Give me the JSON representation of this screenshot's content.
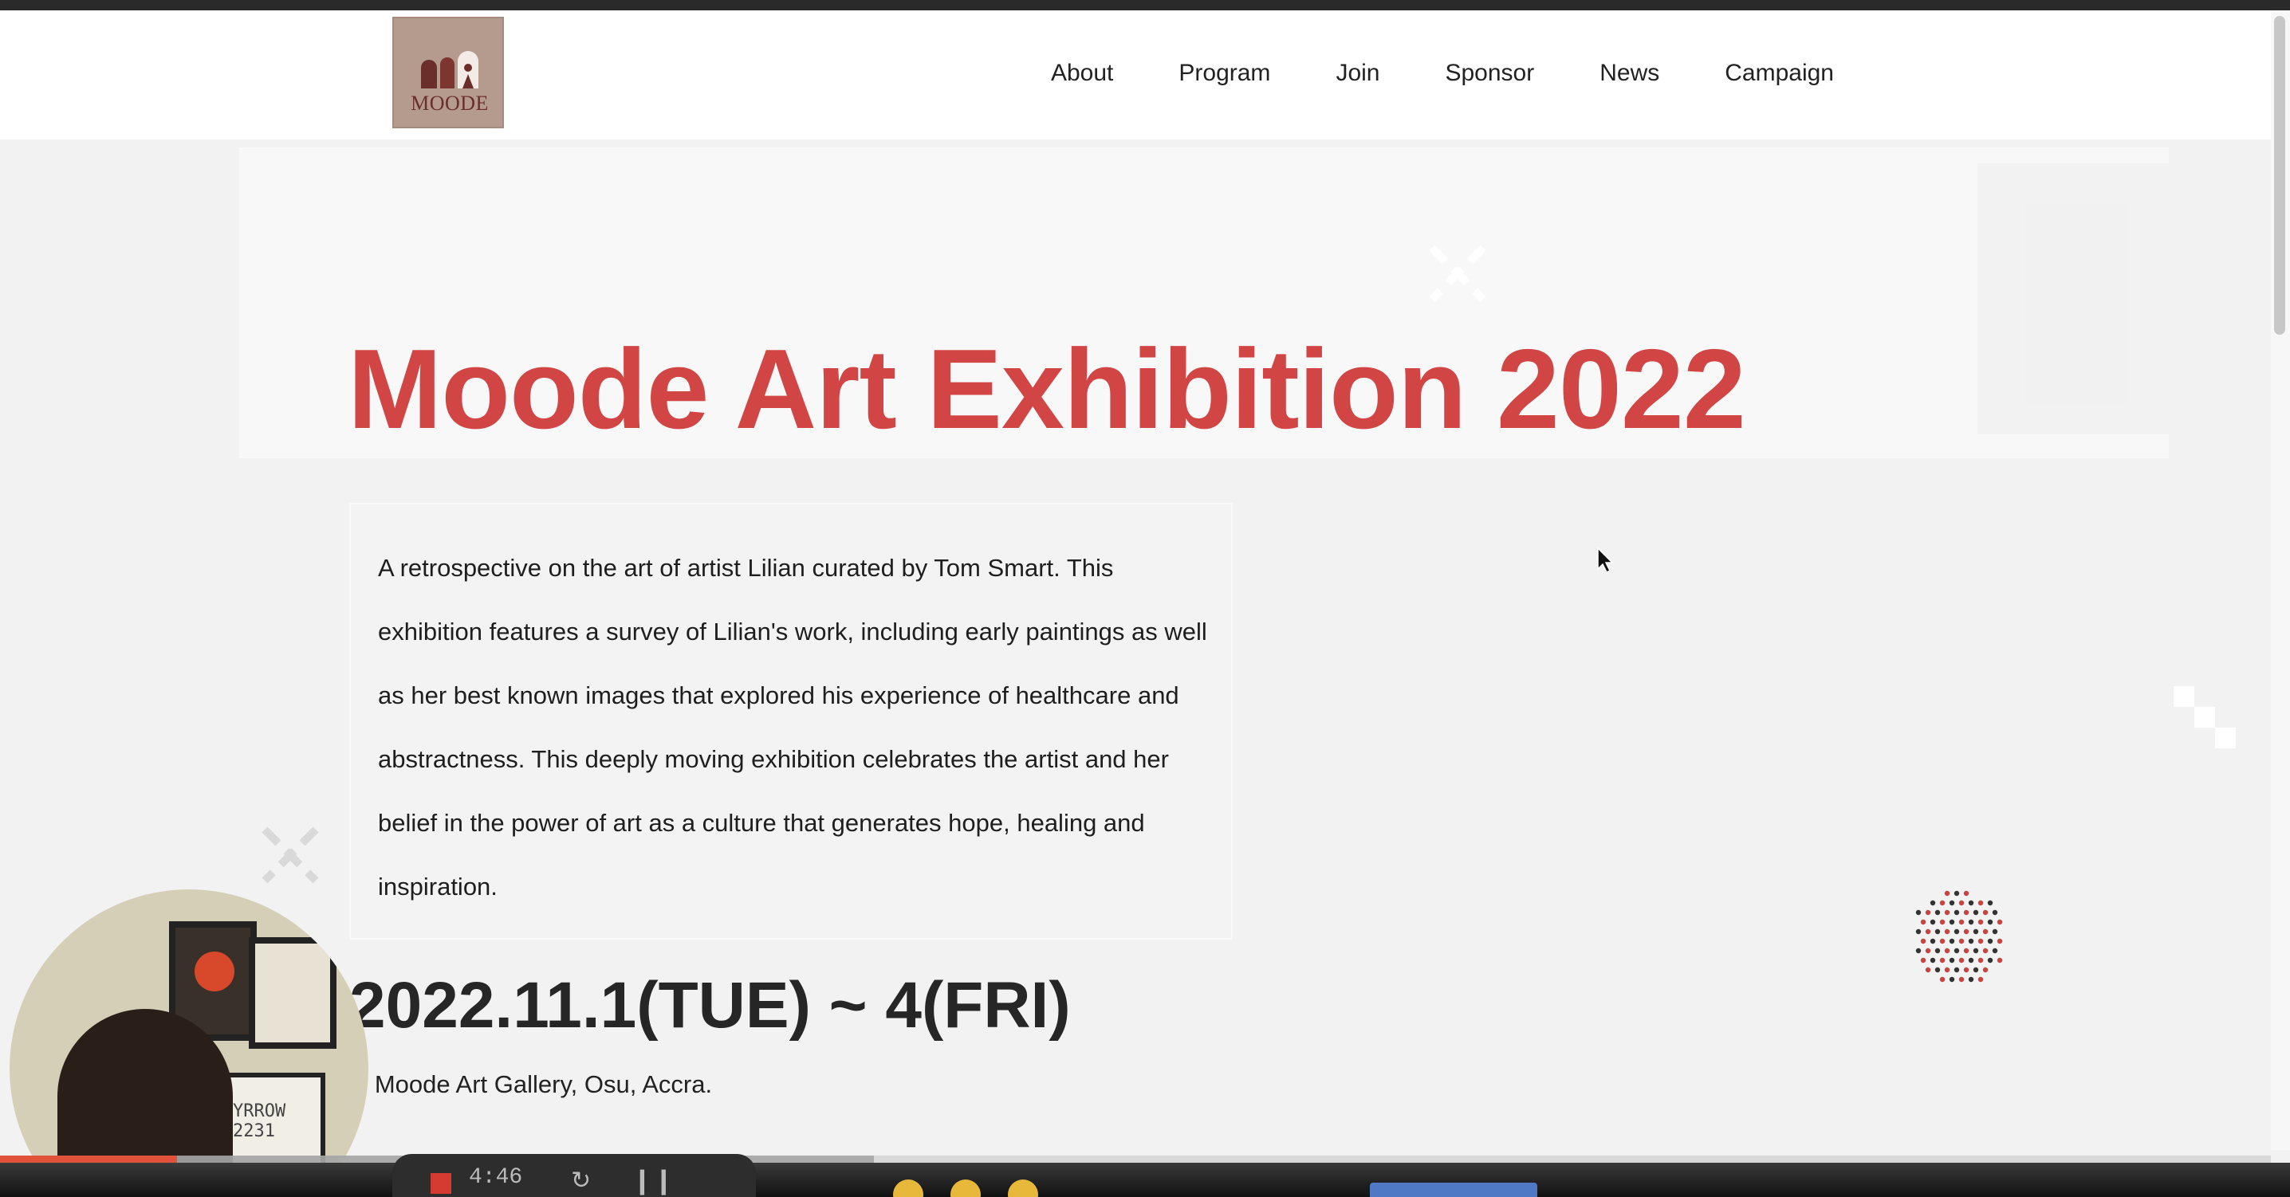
{
  "header": {
    "logo_text": "MOODE",
    "nav": [
      "About",
      "Program",
      "Join",
      "Sponsor",
      "News",
      "Campaign"
    ]
  },
  "hero": {
    "title": "Moode Art Exhibition 2022",
    "description": "A retrospective on the art of artist Lilian curated by Tom Smart. This exhibition features a survey of Lilian's work, including early paintings as well as her best known images that explored his experience of healthcare and abstractness. This deeply moving exhibition celebrates the artist and her belief in the power of art as a culture that generates hope, healing and inspiration.",
    "date": "2022.11.1(TUE) ~ 4(FRI)",
    "venue": "e Moode Art Gallery, Osu, Accra."
  },
  "video_overlay": {
    "elapsed": "4:46",
    "progress_fraction": 0.078,
    "buffered_fraction": 0.307
  },
  "webcam": {
    "frame_text_line1": "YRROW",
    "frame_text_line2": "2231"
  },
  "colors": {
    "title": "#d24545",
    "logo_bg": "#b59a8e",
    "progress": "#e0523a"
  }
}
